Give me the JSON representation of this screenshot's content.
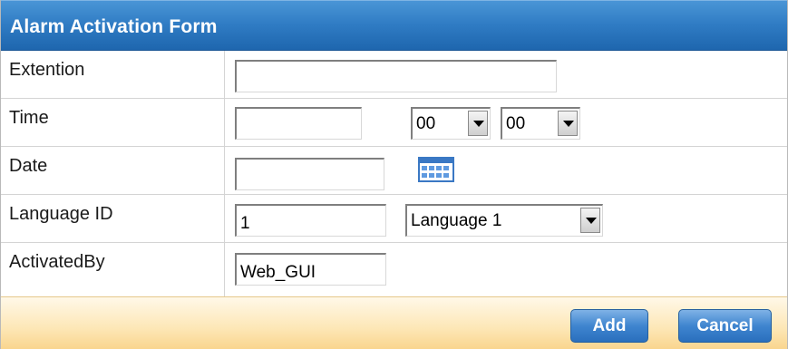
{
  "form": {
    "title": "Alarm Activation Form",
    "fields": {
      "extension": {
        "label": "Extention",
        "value": ""
      },
      "time": {
        "label": "Time",
        "value": "",
        "hour": "00",
        "minute": "00"
      },
      "date": {
        "label": "Date",
        "value": "",
        "icon": "calendar-icon"
      },
      "language": {
        "label": "Language ID",
        "value": "1",
        "selected": "Language 1"
      },
      "activated_by": {
        "label": "ActivatedBy",
        "value": "Web_GUI"
      }
    },
    "buttons": {
      "add": "Add",
      "cancel": "Cancel"
    },
    "colors": {
      "title_bar": "#2f7bc3",
      "footer": "#fde7b6",
      "button": "#3f85cf"
    }
  }
}
